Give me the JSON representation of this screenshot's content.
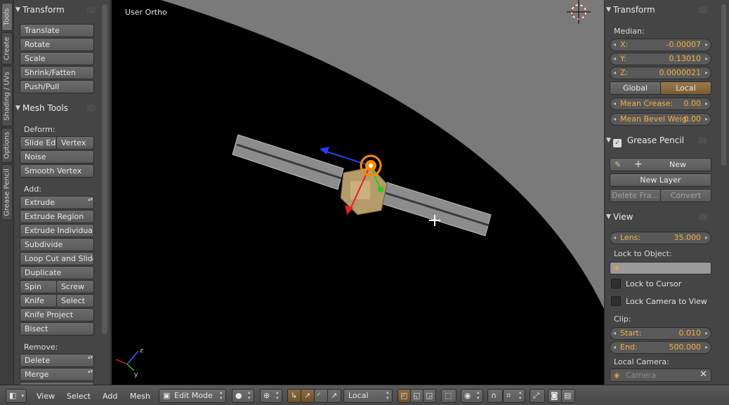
{
  "vtabs": [
    "Tools",
    "Create",
    "Shading / UVs",
    "Options",
    "Grease Pencil"
  ],
  "left": {
    "transform": {
      "title": "Transform",
      "buttons": [
        "Translate",
        "Rotate",
        "Scale",
        "Shrink/Fatten",
        "Push/Pull"
      ]
    },
    "mesh_tools": {
      "title": "Mesh Tools",
      "deform_label": "Deform:",
      "slide_edge": "Slide Ed",
      "vertex": "Vertex",
      "noise": "Noise",
      "smooth_vertex": "Smooth Vertex",
      "add_label": "Add:",
      "extrude": "Extrude",
      "extrude_region": "Extrude Region",
      "extrude_individual": "Extrude Individual",
      "subdivide": "Subdivide",
      "loop_cut": "Loop Cut and Slide",
      "duplicate": "Duplicate",
      "spin": "Spin",
      "screw": "Screw",
      "knife": "Knife",
      "select": "Select",
      "knife_project": "Knife Project",
      "bisect": "Bisect",
      "remove_label": "Remove:",
      "delete": "Delete",
      "merge": "Merge"
    }
  },
  "viewport": {
    "label": "User Ortho"
  },
  "right": {
    "transform": {
      "title": "Transform",
      "median_label": "Median:",
      "x_label": "X:",
      "x": "-0.00007",
      "y_label": "Y:",
      "y": "0.13010",
      "z_label": "Z:",
      "z": "0.0000021",
      "global": "Global",
      "local": "Local",
      "crease_label": "Mean Crease:",
      "crease": "0.00",
      "bevel_label": "Mean Bevel Weig:",
      "bevel": "0.00"
    },
    "grease_pencil": {
      "title": "Grease Pencil",
      "new": "New",
      "new_layer": "New Layer",
      "delete_frame": "Delete Fra...",
      "convert": "Convert"
    },
    "view": {
      "title": "View",
      "lens_label": "Lens:",
      "lens": "35.000",
      "lock_object_label": "Lock to Object:",
      "lock_cursor": "Lock to Cursor",
      "lock_camera": "Lock Camera to View",
      "clip_label": "Clip:",
      "start_label": "Start:",
      "start": "0.010",
      "end_label": "End:",
      "end": "500.000",
      "local_camera_label": "Local Camera:",
      "camera_placeholder": "Camera"
    }
  },
  "header": {
    "menus": [
      "View",
      "Select",
      "Add",
      "Mesh"
    ],
    "mode": "Edit Mode",
    "orientation": "Local"
  },
  "colors": {
    "accent": "#f0b040",
    "active_toggle": "#8a6a40",
    "panel": "#454545"
  }
}
